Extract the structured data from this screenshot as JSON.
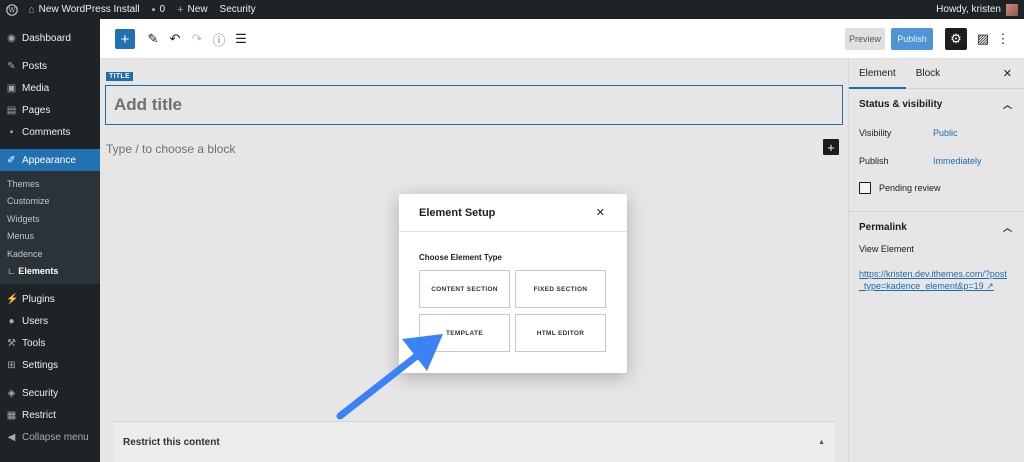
{
  "admin_bar": {
    "site_name": "New WordPress Install",
    "comments_count": "0",
    "new_label": "New",
    "security_label": "Security",
    "howdy": "Howdy, kristen"
  },
  "sidebar": {
    "items": [
      {
        "label": "Dashboard",
        "icon": "dashboard-icon"
      },
      {
        "label": "Posts",
        "icon": "pin-icon"
      },
      {
        "label": "Media",
        "icon": "media-icon"
      },
      {
        "label": "Pages",
        "icon": "pages-icon"
      },
      {
        "label": "Comments",
        "icon": "comment-icon"
      },
      {
        "label": "Appearance",
        "icon": "brush-icon"
      },
      {
        "label": "Plugins",
        "icon": "plugin-icon"
      },
      {
        "label": "Users",
        "icon": "user-icon"
      },
      {
        "label": "Tools",
        "icon": "wrench-icon"
      },
      {
        "label": "Settings",
        "icon": "settings-icon"
      },
      {
        "label": "Security",
        "icon": "shield-icon"
      },
      {
        "label": "Restrict",
        "icon": "lock-icon"
      },
      {
        "label": "Collapse menu",
        "icon": "collapse-icon"
      }
    ],
    "submenu": [
      "Themes",
      "Customize",
      "Widgets",
      "Menus",
      "Kadence",
      "∟ Elements"
    ]
  },
  "toolbar": {
    "preview_label": "Preview",
    "publish_label": "Publish"
  },
  "editor": {
    "title_tag": "TITLE",
    "title_placeholder": "Add title",
    "block_placeholder": "Type / to choose a block",
    "restrict_panel": "Restrict this content"
  },
  "settings": {
    "tab_element": "Element",
    "tab_block": "Block",
    "status_heading": "Status & visibility",
    "visibility_label": "Visibility",
    "visibility_value": "Public",
    "publish_label": "Publish",
    "publish_value": "Immediately",
    "pending_label": "Pending review",
    "permalink_heading": "Permalink",
    "view_element": "View Element",
    "permalink_url": "https://kristen.dev.ithemes.com/?post_type=kadence_element&p=19"
  },
  "modal": {
    "title": "Element Setup",
    "subtitle": "Choose Element Type",
    "types": [
      "CONTENT SECTION",
      "FIXED SECTION",
      "TEMPLATE",
      "HTML EDITOR"
    ]
  },
  "colors": {
    "admin_dark": "#1d2327",
    "accent_blue": "#2271b1",
    "arrow_blue": "#3b82f6"
  }
}
